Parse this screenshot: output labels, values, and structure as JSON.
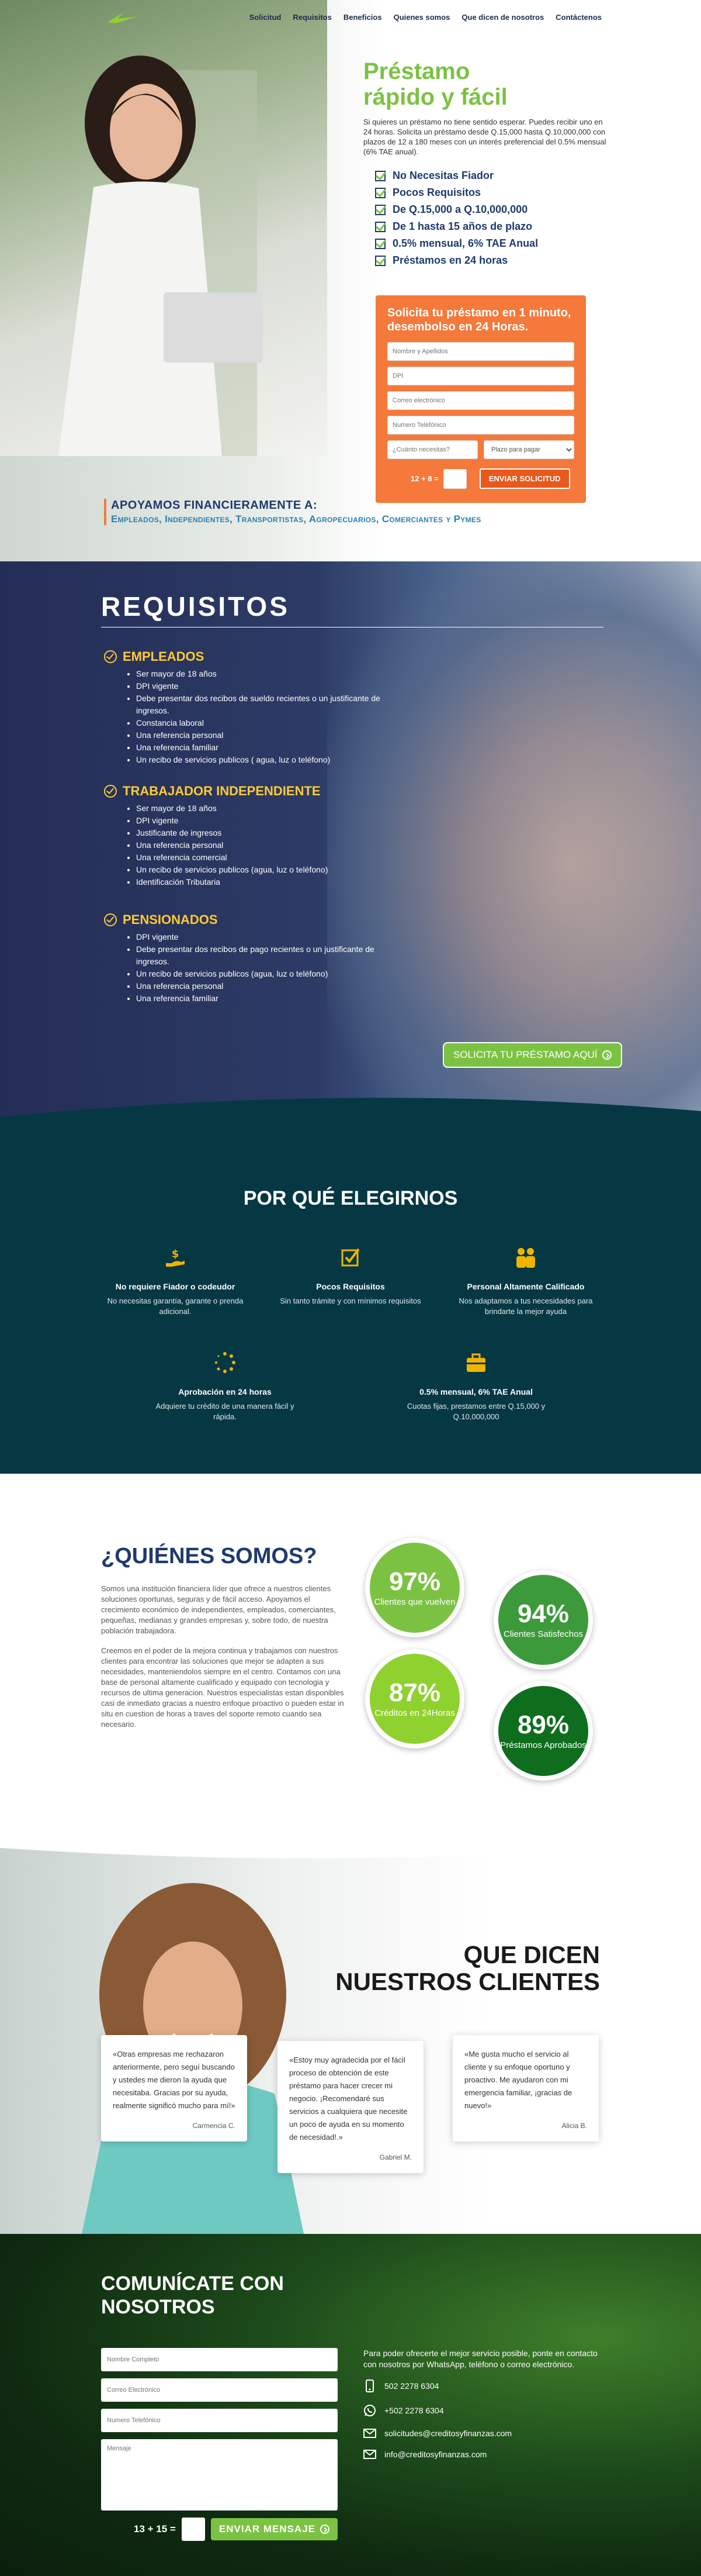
{
  "nav": {
    "items": [
      "Solicitud",
      "Requisitos",
      "Beneficios",
      "Quienes somos",
      "Que dicen de nosotros",
      "Contáctenos"
    ]
  },
  "hero": {
    "title_line1": "Préstamo",
    "title_line2": "rápido y fácil",
    "description": "Si quieres un préstamo no tiene sentido esperar. Puedes recibir uno en 24 horas. Solicita un préstamo desde Q.15,000 hasta Q.10,000,000 con plazos de 12 a 180 meses con un interés preferencial del 0.5% mensual (6% TAE anual).",
    "checks": [
      "No Necesitas Fiador",
      "Pocos Requisitos",
      "De Q.15,000 a Q.10,000,000",
      "De 1 hasta 15 años de plazo",
      "0.5% mensual, 6% TAE Anual",
      "Préstamos en 24 horas"
    ]
  },
  "form": {
    "title": "Solicita tu préstamo en 1 minuto, desembolso en 24 Horas.",
    "name_placeholder": "Nombre y Apellidos",
    "dpi_placeholder": "DPI",
    "email_placeholder": "Correo electrónico",
    "phone_placeholder": "Numero Telefónico",
    "amount_placeholder": "¿Cuánto necesitas?",
    "term_placeholder": "Plazo para pagar",
    "captcha": "12 + 8 =",
    "submit": "ENVIAR SOLICITUD"
  },
  "support": {
    "title": "APOYAMOS FINANCIERAMENTE A:",
    "list": "Empleados, Independientes, Transportistas, Agropecuarios, Comerciantes y Pymes"
  },
  "requisitos": {
    "title": "REQUISITOS",
    "groups": [
      {
        "title": "EMPLEADOS",
        "items": [
          "Ser mayor de 18 años",
          "DPI vigente",
          "Debe presentar dos recibos de sueldo recientes o un justificante de ingresos.",
          "Constancia laboral",
          "Una referencia personal",
          "Una referencia familiar",
          "Un recibo de servicios publicos ( agua, luz o teléfono)"
        ]
      },
      {
        "title": "TRABAJADOR INDEPENDIENTE",
        "items": [
          "Ser mayor de 18 años",
          "DPI vigente",
          "Justificante de ingresos",
          "Una referencia personal",
          "Una referencia comercial",
          "Un recibo de servicios publicos (agua, luz o teléfono)",
          "Identificación Tributaria"
        ]
      },
      {
        "title": "PENSIONADOS",
        "items": [
          "DPI vigente",
          "Debe presentar dos recibos de pago recientes o un justificante de ingresos.",
          "Un recibo de servicios publicos (agua, luz o teléfono)",
          "Una referencia personal",
          "Una referencia familiar"
        ]
      }
    ],
    "cta": "SOLICITA TU PRÉSTAMO AQUÍ"
  },
  "why": {
    "title": "POR QUÉ ELEGIRNOS",
    "features": [
      {
        "icon": "hand-money-icon",
        "title": "No requiere Fiador o codeudor",
        "text": "No necesitas garantía, garante o prenda adicional."
      },
      {
        "icon": "checklist-icon",
        "title": "Pocos Requisitos",
        "text": "Sin tanto trámite y con mínimos requisitos"
      },
      {
        "icon": "team-icon",
        "title": "Personal Altamente Calificado",
        "text": "Nos adaptamos a tus necesidades para brindarte la mejor ayuda"
      },
      {
        "icon": "loading-icon",
        "title": "Aprobación en 24 horas",
        "text": "Adquiere tu crédito de una manera fácil y rápida."
      },
      {
        "icon": "briefcase-icon",
        "title": "0.5% mensual, 6% TAE Anual",
        "text": "Cuotas fijas, prestamos entre Q.15,000 y Q.10,000,000"
      }
    ],
    "icon_color": "#f0b400"
  },
  "who": {
    "title": "¿QUIÉNES SOMOS?",
    "p1": "Somos una institución financiera líder que ofrece a nuestros clientes soluciones oportunas, seguras y de fácil acceso. Apoyamos el crecimiento económico de independientes, empleados, comerciantes, pequeñas, medianas y grandes empresas y, sobre todo, de nuestra población trabajadora.",
    "p2": "Creemos en el poder de la mejora continua y trabajamos con nuestros clientes para encontrar las soluciones que mejor se adapten a sus necesidades, manteniendolos siempre en el centro. Contamos con una base de personal altamente cualificado y equipado con tecnologia y recursos de ultima generacion. Nuestros especialistas estan disponibles casi de inmediato gracias a nuestro enfoque proactivo o pueden estar in situ en cuestion de horas a traves del soporte remoto cuando sea necesario.",
    "stats": [
      {
        "value": "97%",
        "label": "Clientes que vuelven",
        "color": "#7cc242"
      },
      {
        "value": "94%",
        "label": "Clientes Satisfechos",
        "color": "#3c9a3a"
      },
      {
        "value": "87%",
        "label": "Créditos en 24Horas",
        "color": "#8fd12e"
      },
      {
        "value": "89%",
        "label": "Préstamos Aprobados",
        "color": "#0e6e1e"
      }
    ]
  },
  "testimonials": {
    "title_line1": "QUE DICEN",
    "title_line2": "NUESTROS CLIENTES",
    "items": [
      {
        "text": "«Otras empresas me rechazaron anteriormente, pero seguí buscando y ustedes me dieron la ayuda que necesitaba. Gracias por su ayuda, realmente significó mucho para mí!»",
        "author": "Carmencia C."
      },
      {
        "text": "«Estoy muy agradecida por el fácil proceso de obtención de este préstamo para hacer crecer mi negocio. ¡Recomendaré sus servicios a cualquiera que necesite un poco de ayuda en su momento de necesidad!.»",
        "author": "Gabriel M."
      },
      {
        "text": "«Me gusta mucho el servicio al cliente y su enfoque oportuno y proactivo. Me ayudaron con mi emergencia familiar, ¡gracias de nuevo!»",
        "author": "Alicia B."
      }
    ]
  },
  "contact": {
    "title_line1": "COMUNÍCATE CON",
    "title_line2": "NOSOTROS",
    "name_placeholder": "Nombre Completo",
    "email_placeholder": "Correo Electrónico",
    "phone_placeholder": "Numero Telefónico",
    "message_placeholder": "Mensaje",
    "captcha": "13 + 15 =",
    "submit": "ENVIAR MENSAJE",
    "intro": "Para poder ofrecerte el mejor servicio posible, ponte en contacto con nosotros por WhatsApp, teléfono o correo electrónico.",
    "phone": "502 2278 6304",
    "whatsapp": "+502 2278 6304",
    "email1": "solicitudes@creditosyfinanzas.com",
    "email2": "info@creditosyfinanzas.com"
  }
}
